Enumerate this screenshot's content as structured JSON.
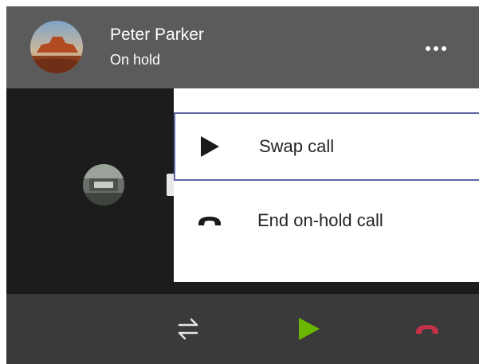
{
  "header": {
    "contact_name": "Peter Parker",
    "call_status": "On hold",
    "more_icon": "more-horizontal-icon"
  },
  "menu": {
    "items": [
      {
        "label": "Swap call",
        "icon": "play-icon",
        "selected": true
      },
      {
        "label": "End on-hold call",
        "icon": "hang-up-icon",
        "selected": false
      }
    ]
  },
  "toolbar": {
    "buttons": [
      {
        "icon": "swap-arrows-icon",
        "color": "#e6e6e6"
      },
      {
        "icon": "resume-play-icon",
        "color": "#6bb700"
      },
      {
        "icon": "end-call-icon",
        "color": "#c4314b"
      }
    ]
  },
  "colors": {
    "header_bg": "#5b5b5b",
    "content_bg": "#1c1c1c",
    "toolbar_bg": "#3a3a3a",
    "selection_border": "#6264a7"
  }
}
